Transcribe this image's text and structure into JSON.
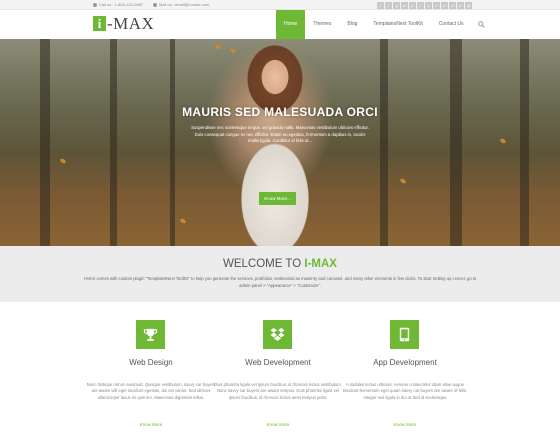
{
  "topbar": {
    "phone": "Call us : 1-800-123-0987",
    "email": "Mail us : email@i-craze.com",
    "social": [
      "f",
      "t",
      "g",
      "in",
      "p",
      "r",
      "y",
      "v",
      "s",
      "d",
      "b",
      "@"
    ]
  },
  "header": {
    "logo_box": "i",
    "logo_text": "-MAX",
    "nav": [
      "Home",
      "Themes",
      "Blog",
      "TemplatesNext ToolKit",
      "Contact Us"
    ]
  },
  "hero": {
    "title": "MAURIS SED MALESUADA ORCI",
    "subtitle": "Suspendisse nec scelerisque neque, vel gravida nulla. Maecenas vestibulum ultricies efficitur. Duis consequat congue ex nec efficitur. Etiam eu egestas, fermentum a dapibus in, iaculis mollis ligula. Curabitur id felis ut...",
    "button": "Know More..."
  },
  "welcome": {
    "title_prefix": "WELCOME TO ",
    "title_brand": "I-MAX",
    "description": "I-MAX comes with custom plugin \"TemplatesNext ToolKit\" to help you generate the services, portfolios, testimonial as masonry and carousel, and many other elements in few clicks. To start Setting up i-excel, go to admin panel > \"Appearance\" > \"Customize\"."
  },
  "features": [
    {
      "title": "Web Design",
      "text": "Nunc tristique rutrum euismod. Quisque vestibulum, savvy car buyers are aware will eget tincidunt egestas, dui est varius. Sed ultrices ullamcorper lacus mi quis leo. Maecenas dignissim tellus.",
      "more": "Know More"
    },
    {
      "title": "Web Development",
      "text": "Duis pharetra ligula vel ipsum faucibus, id rhoncus lectus vestibulum. Nunc savvy car buyers are aware tempus. Duis pharetra ligula vel ipsum faucibus, id rhoncus lectus amet tempus justo.",
      "more": "Know More"
    },
    {
      "title": "App Development",
      "text": "A sodales lectus ultricies. Aenean consectetur diam vitae augue tincidunt fermentum eget quam savvy car buyers are aware of felis. Integer sed ligula in dui ut Sed id scelerisque",
      "more": "Know More"
    }
  ],
  "colors": {
    "accent": "#6fb836"
  },
  "icons": [
    "trophy-icon",
    "dropbox-icon",
    "tablet-icon",
    "search-icon"
  ]
}
